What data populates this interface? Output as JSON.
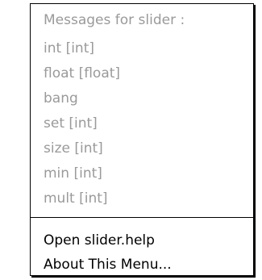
{
  "menu": {
    "header": "Messages for slider :",
    "messages": [
      "int [int]",
      "float [float]",
      "bang",
      "set [int]",
      "size [int]",
      "min [int]",
      "mult [int]"
    ],
    "actions": [
      "Open slider.help",
      "About This Menu..."
    ]
  },
  "colors": {
    "disabled_text": "#9a9a9a",
    "enabled_text": "#000000",
    "border": "#000000",
    "background": "#ffffff"
  }
}
